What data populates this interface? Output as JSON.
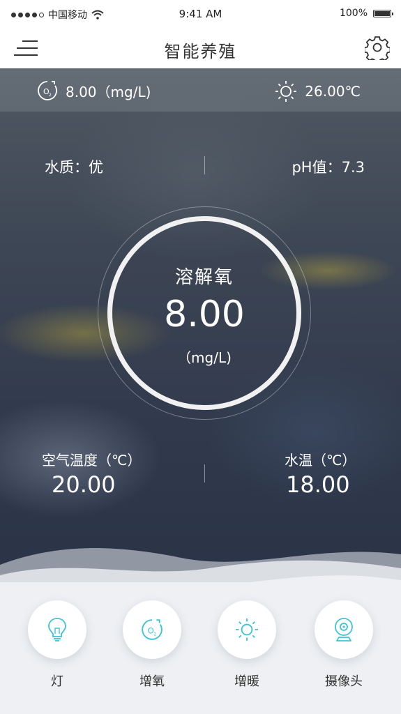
{
  "status_bar": {
    "carrier": "中国移动",
    "time": "9:41 AM",
    "battery": "100%"
  },
  "nav": {
    "title": "智能养殖",
    "menu_icon": "menu-icon",
    "settings_icon": "gear-icon"
  },
  "top_strip": {
    "o2_value": "8.00（mg/L)",
    "temperature": "26.00℃",
    "o2_icon": "o2-icon",
    "sun_icon": "sun-icon"
  },
  "quality": {
    "water_quality": "水质：优",
    "ph": "pH值：7.3"
  },
  "dissolved_oxygen": {
    "label": "溶解氧",
    "value": "8.00",
    "unit": "（mg/L)"
  },
  "air_temp": {
    "label": "空气温度（℃）",
    "value": "20.00"
  },
  "water_temp": {
    "label": "水温（℃）",
    "value": "18.00"
  },
  "controls": [
    {
      "label": "灯",
      "icon": "bulb-icon"
    },
    {
      "label": "增氧",
      "icon": "o2-icon"
    },
    {
      "label": "增暖",
      "icon": "sun-icon"
    },
    {
      "label": "摄像头",
      "icon": "camera-icon"
    }
  ],
  "colors": {
    "accent": "#3fc3d8",
    "nav_bg": "#ffffff",
    "bottom_bg": "#eef0f3"
  }
}
